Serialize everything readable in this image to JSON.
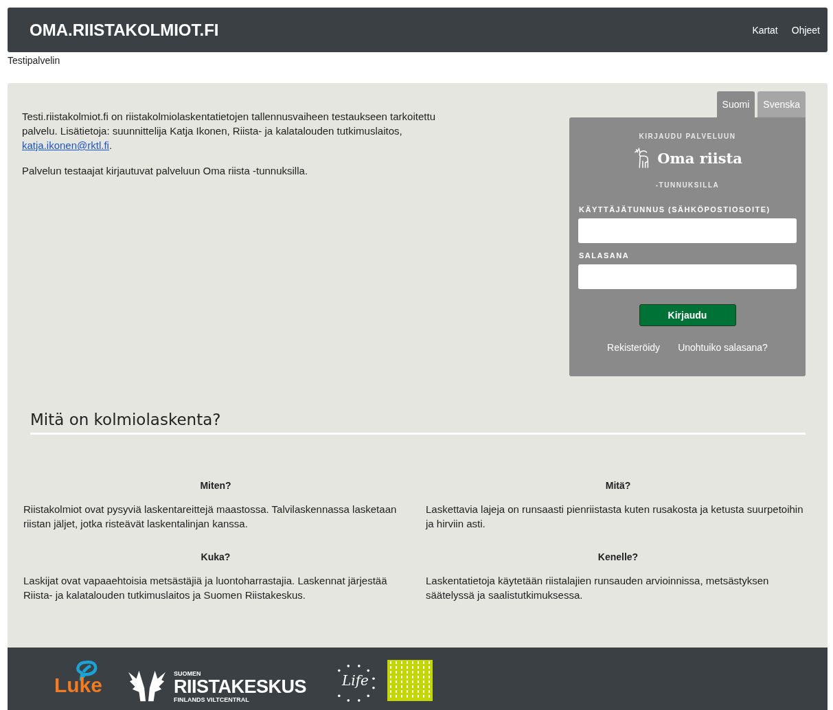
{
  "header": {
    "title": "OMA.RIISTAKOLMIOT.FI",
    "nav": [
      "Kartat",
      "Ohjeet"
    ]
  },
  "subtitle": "Testipalvelin",
  "intro": {
    "paragraphs": [
      {
        "text": "Testi.riistakolmiot.fi on riistakolmiolaskentatietojen tallennusvaiheen testaukseen tarkoitettu palvelu. Lisätietoja: suunnittelija Katja Ikonen, Riista- ja kalatalouden tutkimuslaitos, ",
        "link": "katja.ikonen@rktl.fi",
        "after": "."
      },
      {
        "text": "Palvelun testaajat kirjautuvat palveluun Oma riista -tunnuksilla."
      }
    ]
  },
  "login": {
    "tabs": [
      {
        "label": "Suomi",
        "selected": true
      },
      {
        "label": "Svenska",
        "selected": false
      }
    ],
    "heading": "KIRJAUDU PALVELUUN",
    "brand": "Oma riista",
    "brand_suffix": "-TUNNUKSILLA",
    "fields": [
      {
        "label": "KÄYTTÄJÄTUNNUS (SÄHKÖPOSTIOSOITE)"
      },
      {
        "label": "SALASANA"
      }
    ],
    "submit": "Kirjaudu",
    "links": [
      "Rekisteröidy",
      "Unohtuiko salasana?"
    ]
  },
  "section": {
    "title": "Mitä on kolmiolaskenta?",
    "items": [
      {
        "heading": "Miten?",
        "text": "Riistakolmiot ovat pysyviä laskentareittejä maastossa. Talvilaskennassa lasketaan riistan jäljet, jotka risteävät laskentalinjan kanssa."
      },
      {
        "heading": "Mitä?",
        "text": "Laskettavia lajeja on runsaasti pienriistasta kuten rusakosta ja ketusta suurpetoihin ja hirviin asti."
      },
      {
        "heading": "Kuka?",
        "text": "Laskijat ovat vapaaehtoisia metsästäjiä ja luontoharrastajia. Laskennat järjestää Riista- ja kalatalouden tutkimuslaitos ja Suomen Riistakeskus."
      },
      {
        "heading": "Kenelle?",
        "text": "Laskentatietoja käytetään riistalajien runsauden arvioinnissa, metsästyksen säätelyssä ja saalistutkimuksessa."
      }
    ]
  },
  "footer": {
    "logos": [
      {
        "kind": "luke",
        "text": "Luke"
      },
      {
        "kind": "riistakeskus",
        "top": "SUOMEN",
        "text": "RIISTAKESKUS",
        "bottom": "FINLANDS VILTCENTRAL"
      },
      {
        "kind": "life",
        "text": "Life"
      },
      {
        "kind": "pattern"
      }
    ]
  }
}
